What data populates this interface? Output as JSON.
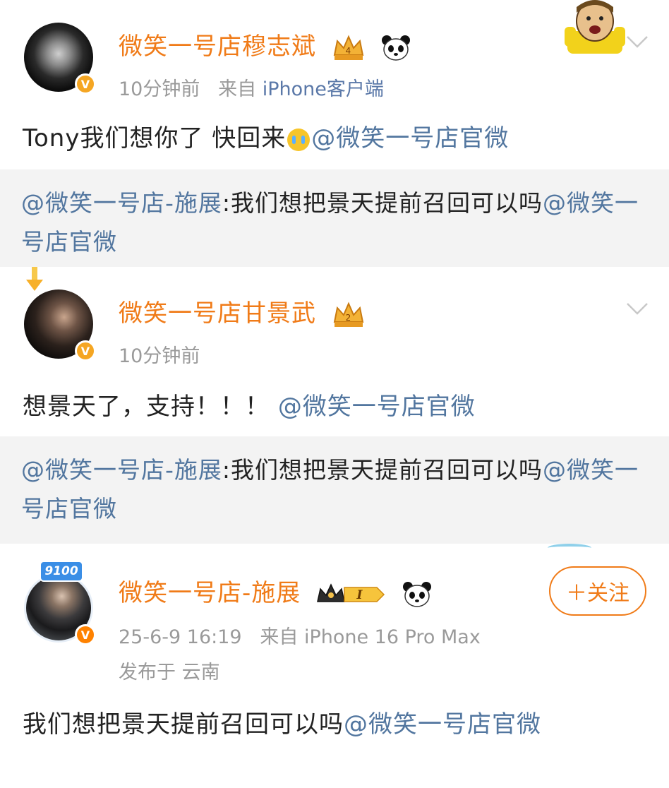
{
  "posts": [
    {
      "name": "微笑一号店穆志斌",
      "time": "10分钟前",
      "from_prefix": "来自",
      "source": "iPhone客户端",
      "text": "Tony我们想你了 快回来",
      "mention": "@微笑一号店官微",
      "quote": {
        "mention": "@微笑一号店-施展",
        "text": ":我们想把景天提前召回可以吗",
        "tail_mention": "@微笑一号店官微"
      }
    },
    {
      "name": "微笑一号店甘景武",
      "time": "10分钟前",
      "text": "想景天了，支持！！！",
      "mention": "@微笑一号店官微",
      "quote": {
        "mention": "@微笑一号店-施展",
        "text": ":我们想把景天提前召回可以吗",
        "tail_mention": "@微笑一号店官微"
      }
    },
    {
      "name": "微笑一号店-施展",
      "badge_level": "I",
      "time": "25-6-9 16:19",
      "from_prefix": "来自",
      "source": "iPhone 16 Pro Max",
      "location": "发布于 云南",
      "follow_label": "＋关注",
      "tag": "9100",
      "text": "我们想把景天提前召回可以吗",
      "mention": "@微笑一号店官微"
    }
  ],
  "colors": {
    "name": "#f07b18",
    "mention": "#52769f",
    "meta": "#9a9a9a",
    "quote_bg": "#f3f3f3",
    "verified": "#f5a623"
  },
  "icons": [
    "crown-badge-icon",
    "panda-icon",
    "verified-v-icon",
    "chevron-down-icon",
    "sticker-icon"
  ]
}
